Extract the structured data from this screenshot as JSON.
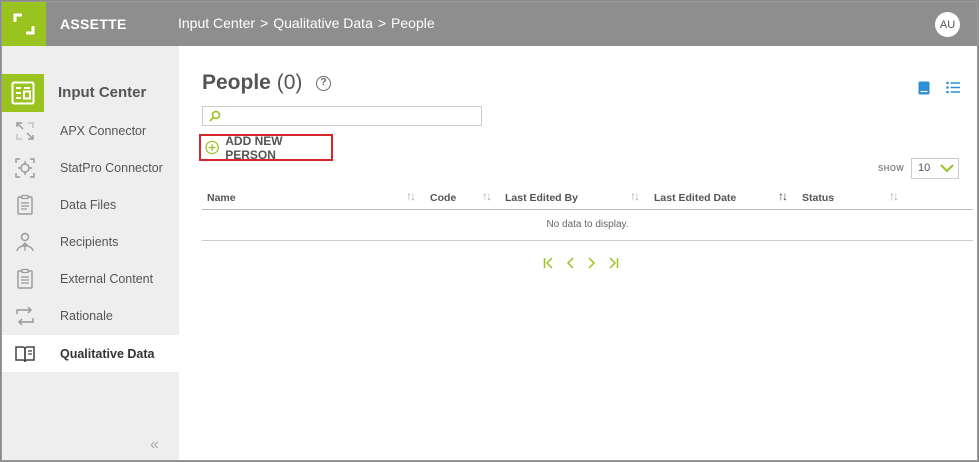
{
  "app": {
    "brand": "ASSETTE",
    "breadcrumb": [
      "Input Center",
      ">",
      "Qualitative Data",
      ">",
      "People"
    ],
    "avatar": "AU"
  },
  "sidebar": {
    "heading": "Input Center",
    "items": [
      {
        "label": "APX Connector",
        "icon": "apx-connector-icon"
      },
      {
        "label": "StatPro Connector",
        "icon": "statpro-connector-icon"
      },
      {
        "label": "Data Files",
        "icon": "data-files-icon"
      },
      {
        "label": "Recipients",
        "icon": "recipients-icon"
      },
      {
        "label": "External Content",
        "icon": "external-content-icon"
      },
      {
        "label": "Rationale",
        "icon": "rationale-icon"
      },
      {
        "label": "Qualitative Data",
        "icon": "book-icon",
        "active": true
      }
    ],
    "collapse": "«"
  },
  "main": {
    "title": "People",
    "count": "(0)",
    "help": "?",
    "add_button": "ADD NEW PERSON",
    "show_label": "SHOW",
    "show_value": "10",
    "columns": [
      "Name",
      "Code",
      "Last Edited By",
      "Last Edited Date",
      "Status"
    ],
    "empty_text": "No data to display."
  },
  "colors": {
    "accent": "#9bc320",
    "topbar": "#8e8e8e",
    "highlight": "#d6252d",
    "view_icon": "#2d8fd6"
  }
}
